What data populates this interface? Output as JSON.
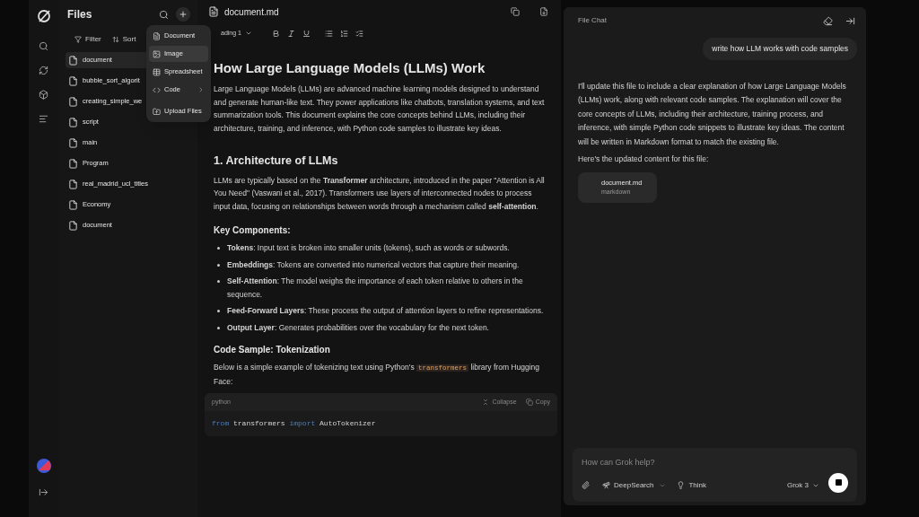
{
  "files_panel": {
    "title": "Files",
    "filter": "Filter",
    "sort": "Sort",
    "items": [
      {
        "name": "document",
        "selected": true
      },
      {
        "name": "bubble_sort_algorit",
        "selected": false
      },
      {
        "name": "creating_simple_we",
        "selected": false
      },
      {
        "name": "script",
        "selected": false
      },
      {
        "name": "main",
        "selected": false
      },
      {
        "name": "Program",
        "selected": false
      },
      {
        "name": "real_madrid_ucl_titles",
        "selected": false
      },
      {
        "name": "Economy",
        "selected": false
      },
      {
        "name": "document",
        "selected": false
      }
    ]
  },
  "new_menu": [
    {
      "label": "Document",
      "kind": "item",
      "selected": false
    },
    {
      "label": "Image",
      "kind": "item",
      "selected": true
    },
    {
      "label": "Spreadsheet",
      "kind": "item",
      "selected": false
    },
    {
      "label": "Code",
      "kind": "submenu",
      "selected": false
    },
    {
      "label": "Upload Files",
      "kind": "item",
      "selected": false
    }
  ],
  "editor": {
    "filename": "document.md",
    "block_style": "ading 1",
    "title": "How Large Language Models (LLMs) Work",
    "intro": "Large Language Models (LLMs) are advanced machine learning models designed to understand and generate human-like text. They power applications like chatbots, translation systems, and text summarization tools. This document explains the core concepts behind LLMs, including their architecture, training, and inference, with Python code samples to illustrate key ideas.",
    "section": "1. Architecture of LLMs",
    "section_text": "LLMs are typically based on the **Transformer** architecture, introduced in the paper \"Attention is All You Need\" (Vaswani et al., 2017). Transformers use layers of interconnected nodes to process input data, focusing on relationships between words through a mechanism called **self-attention**.",
    "subheading": "Key Components:",
    "bullets": [
      "**Tokens**: Input text is broken into smaller units (tokens), such as words or subwords.",
      "**Embeddings**: Tokens are converted into numerical vectors that capture their meaning.",
      "**Self-Attention**: The model weighs the importance of each token relative to others in the sequence.",
      "**Feed-Forward Layers**: These process the output of attention layers to refine representations.",
      "**Output Layer**: Generates probabilities over the vocabulary for the next token."
    ],
    "code_heading": "Code Sample: Tokenization",
    "code_intro": {
      "before": "Below is a simple example of tokenizing text using Python's",
      "code": "transformers",
      "after": "library from Hugging Face:"
    },
    "code_block": {
      "language": "python",
      "collapse": "Collapse",
      "copy": "Copy",
      "tokens": [
        {
          "text": "from",
          "kind": "keyword"
        },
        {
          "text": "transformers",
          "kind": "plain"
        },
        {
          "text": "import",
          "kind": "keyword"
        },
        {
          "text": "AutoTokenizer",
          "kind": "plain"
        }
      ]
    }
  },
  "chat": {
    "title": "File Chat",
    "user_message": "write how LLM works with code samples",
    "reply": "I'll update this file to include a clear explanation of how Large Language Models (LLMs) work, along with relevant code samples. The explanation will cover the core concepts of LLMs, including their architecture, training process, and inference, with simple Python code snippets to illustrate key ideas. The content will be written in Markdown format to match the existing file.",
    "reply_note": "Here's the updated content for this file:",
    "attachment": {
      "name": "document.md",
      "type": "markdown"
    },
    "input": {
      "placeholder": "How can Grok help?",
      "deepsearch": "DeepSearch",
      "think": "Think",
      "model": "Grok 3"
    }
  }
}
